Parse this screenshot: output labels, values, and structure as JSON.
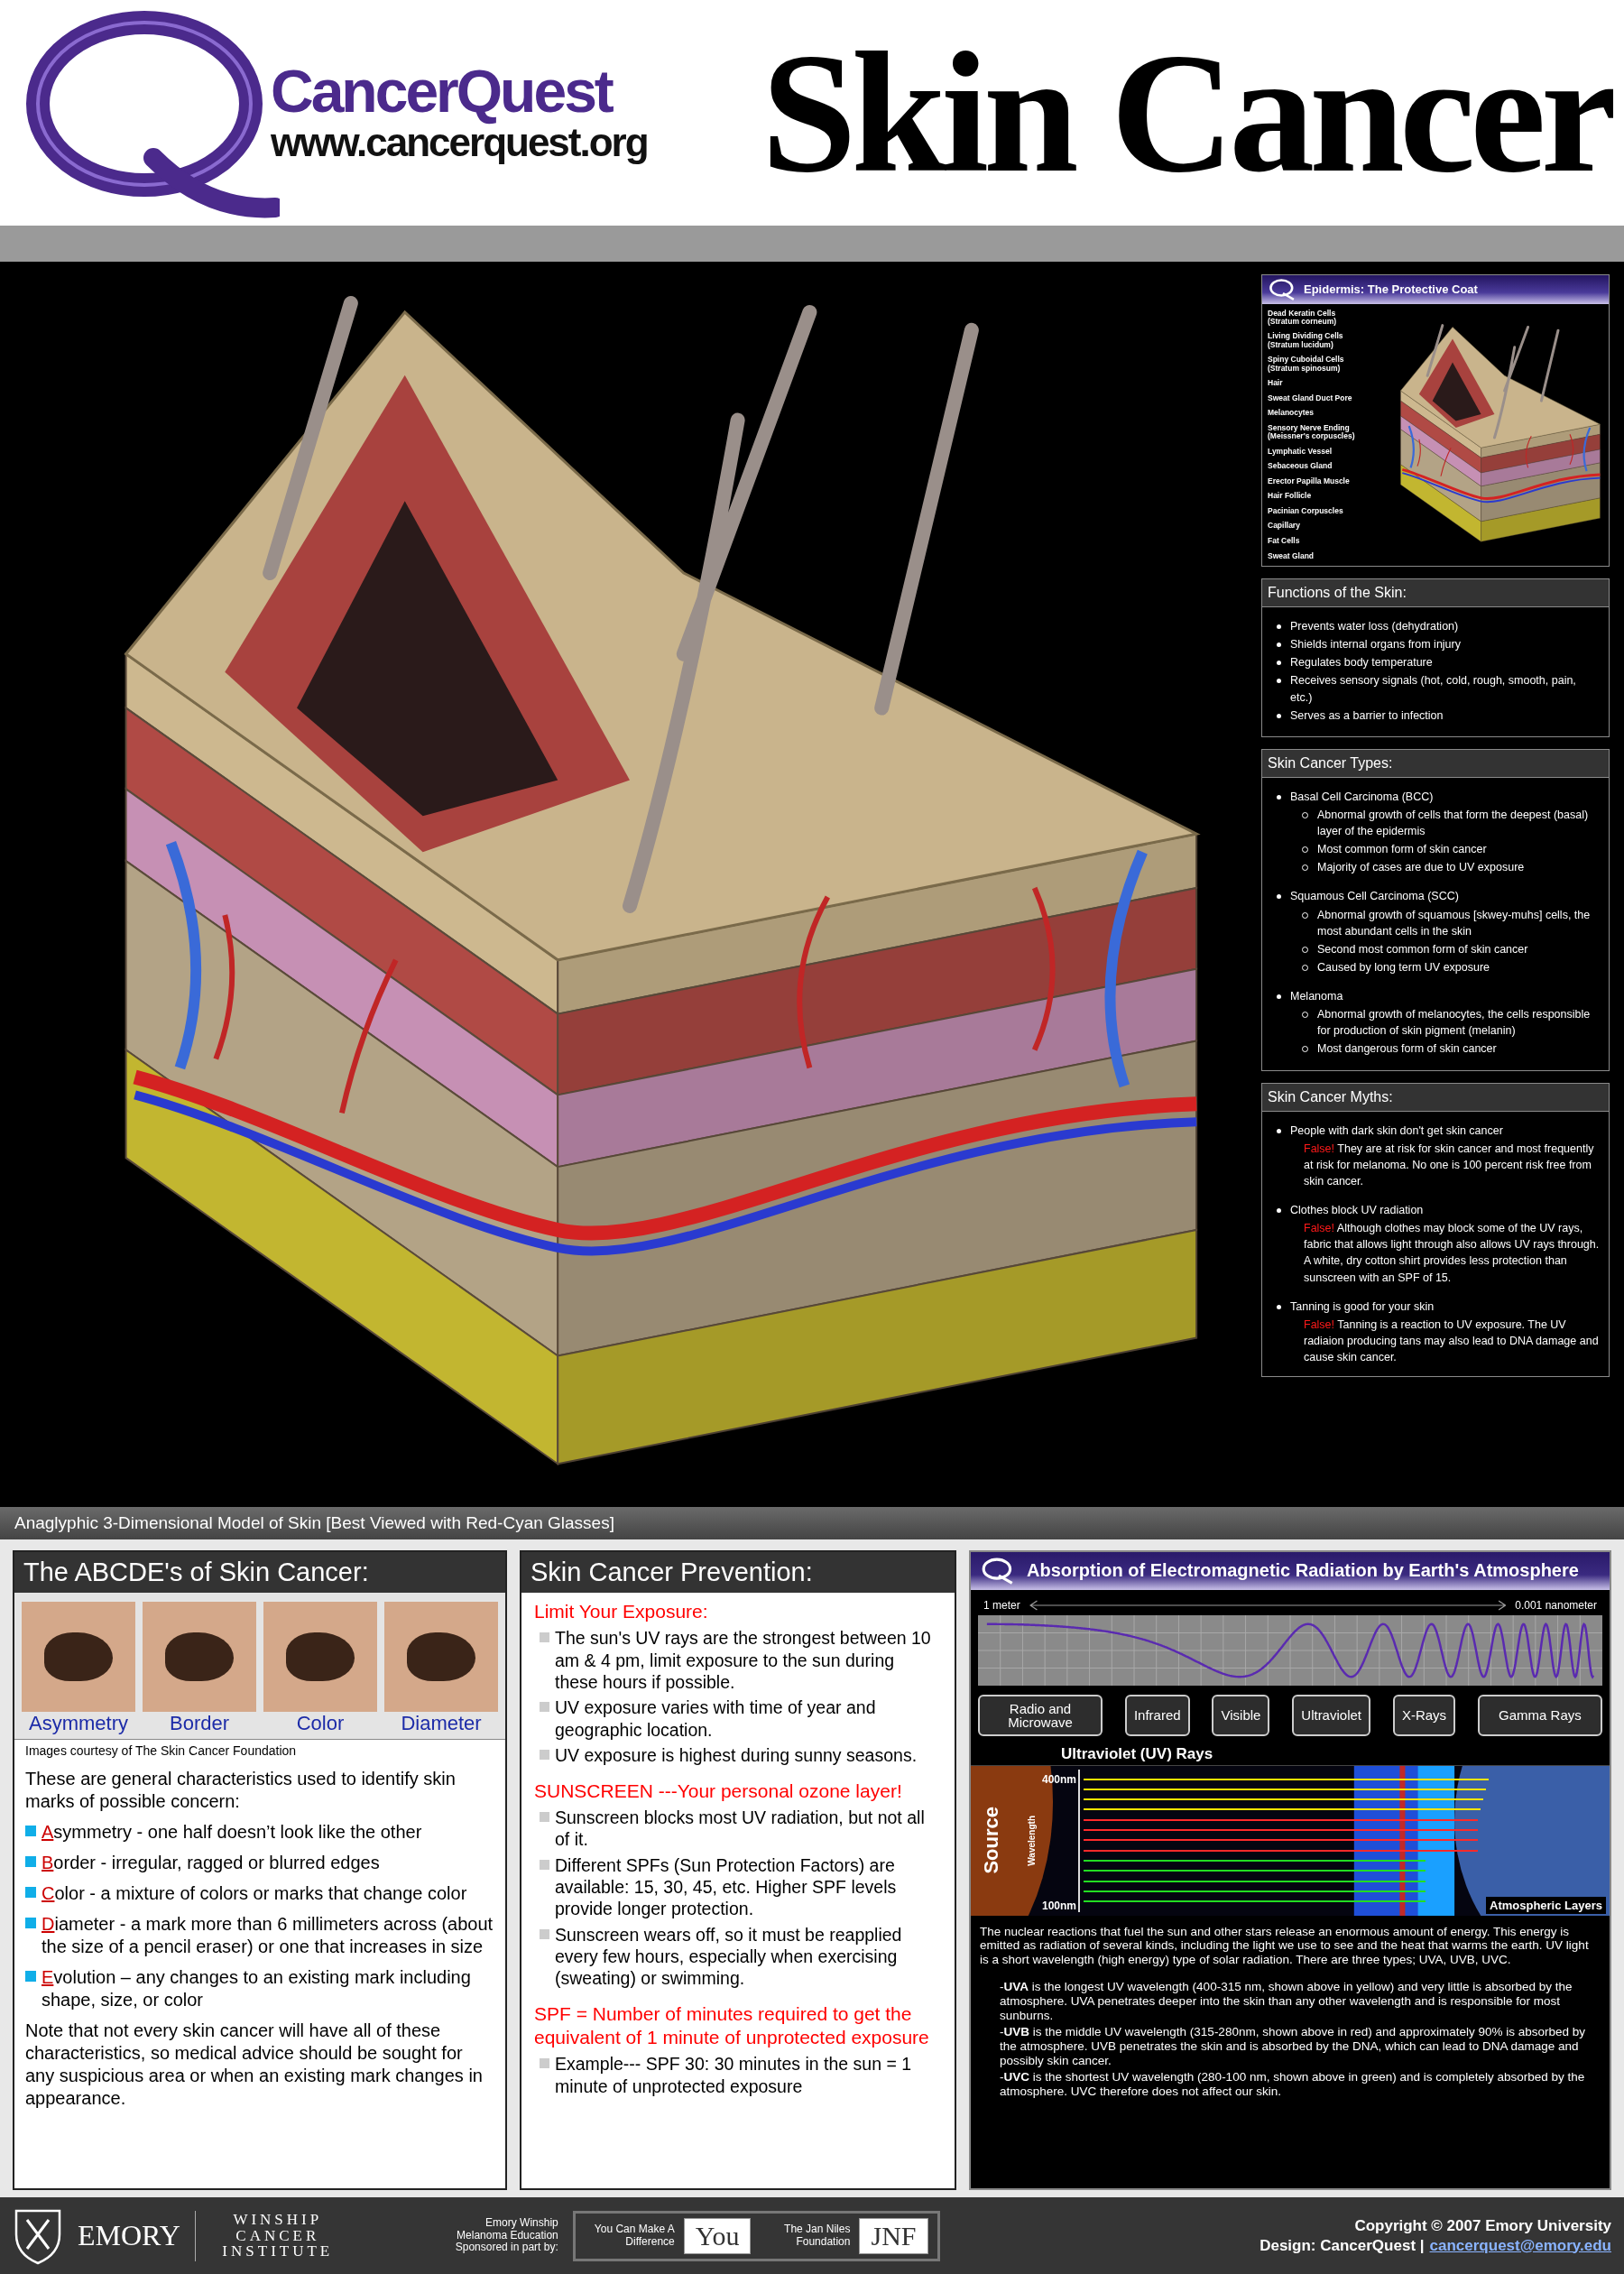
{
  "header": {
    "logo_name": "CancerQuest",
    "logo_url": "www.cancerquest.org",
    "title": "Skin Cancer"
  },
  "epidermis_panel": {
    "title": "Epidermis: The Protective Coat",
    "labels": [
      {
        "name": "Dead Keratin Cells",
        "detail": "(Stratum corneum)"
      },
      {
        "name": "Living Dividing Cells",
        "detail": "(Stratum lucidum)"
      },
      {
        "name": "Spiny Cuboidal Cells",
        "detail": "(Stratum spinosum)"
      },
      {
        "name": "Hair"
      },
      {
        "name": "Sweat Gland Duct Pore"
      },
      {
        "name": "Melanocytes"
      },
      {
        "name": "Sensory Nerve Ending",
        "detail": "(Meissner's corpuscles)"
      },
      {
        "name": "Lymphatic Vessel"
      },
      {
        "name": "Sebaceous Gland"
      },
      {
        "name": "Erector Papilla Muscle"
      },
      {
        "name": "Hair Follicle"
      },
      {
        "name": "Pacinian Corpuscles"
      },
      {
        "name": "Capillary"
      },
      {
        "name": "Fat Cells"
      },
      {
        "name": "Sweat Gland"
      }
    ]
  },
  "functions_panel": {
    "title": "Functions of the Skin:",
    "items": [
      "Prevents water loss (dehydration)",
      "Shields internal organs from injury",
      "Regulates body temperature",
      "Receives sensory signals (hot, cold, rough, smooth, pain, etc.)",
      "Serves as a barrier to infection"
    ]
  },
  "types_panel": {
    "title": "Skin Cancer Types:",
    "items": [
      {
        "name": "Basal Cell Carcinoma (BCC)",
        "details": [
          "Abnormal growth of cells that form the deepest (basal) layer of the epidermis",
          "Most common form of skin cancer",
          "Majority of cases are due to UV exposure"
        ]
      },
      {
        "name": "Squamous Cell Carcinoma (SCC)",
        "details": [
          "Abnormal growth of squamous [skwey-muhs] cells, the most abundant cells in the skin",
          "Second most common form of skin cancer",
          "Caused by long term UV exposure"
        ]
      },
      {
        "name": "Melanoma",
        "details": [
          "Abnormal growth of melanocytes, the cells responsible for production of skin pigment (melanin)",
          "Most dangerous form of skin cancer"
        ]
      }
    ]
  },
  "myths_panel": {
    "title": "Skin Cancer Myths:",
    "items": [
      {
        "myth": "People with dark skin don't get skin cancer",
        "verdict": "False!",
        "explanation": "They are at risk for skin cancer and most frequently at risk for melanoma. No one is 100 percent risk free from skin cancer."
      },
      {
        "myth": "Clothes block UV radiation",
        "verdict": "False!",
        "explanation": "Although clothes may block some of the UV rays, fabric that allows light through also allows UV rays through. A white, dry cotton shirt provides less protection than sunscreen with an SPF of 15."
      },
      {
        "myth": "Tanning is good for your skin",
        "verdict": "False!",
        "explanation": "Tanning is a reaction to UV exposure. The UV radiaion producing tans may also lead to DNA damage and cause skin cancer."
      }
    ]
  },
  "model_caption": "Anaglyphic 3-Dimensional Model of Skin [Best Viewed with Red-Cyan Glasses]",
  "abcde_panel": {
    "title": "The ABCDE's of Skin Cancer:",
    "photos": [
      "Asymmetry",
      "Border",
      "Color",
      "Diameter"
    ],
    "credit": "Images courtesy of The Skin Cancer Foundation",
    "intro": "These are general characteristics used to identify skin marks of possible concern:",
    "items": [
      {
        "initial": "A",
        "text": "symmetry - one half doesn’t look like the other"
      },
      {
        "initial": "B",
        "text": "order - irregular, ragged or blurred edges"
      },
      {
        "initial": "C",
        "text": "olor - a mixture of colors or marks that change color"
      },
      {
        "initial": "D",
        "text": "iameter - a mark more than 6 millimeters across (about the size of a pencil eraser) or one that increases in size"
      },
      {
        "initial": "E",
        "text": "volution – any changes to an existing mark including shape, size, or color"
      }
    ],
    "note": "Note that not every skin cancer will have all of these characteristics, so medical advice should be sought for any suspicious area or when an existing mark changes in appearance."
  },
  "prevention_panel": {
    "title": "Skin Cancer Prevention:",
    "sections": [
      {
        "heading": "Limit Your Exposure:",
        "items": [
          "The sun's UV rays are the strongest between 10 am & 4 pm, limit exposure to the sun during these hours if possible.",
          "UV exposure varies with time of year and geographic location.",
          "UV exposure is highest during sunny seasons."
        ]
      },
      {
        "heading": "SUNSCREEN ---Your personal ozone layer!",
        "items": [
          "Sunscreen blocks most UV radiation, but not all of it.",
          "Different SPFs (Sun Protection Factors) are available: 15, 30, 45, etc.  Higher SPF levels provide longer protection.",
          "Sunscreen wears off, so it must be reapplied every few hours, especially when exercising (sweating) or swimming."
        ]
      },
      {
        "heading": "SPF = Number of minutes required to get the equivalent of 1 minute of unprotected exposure",
        "items": [
          "Example--- SPF 30: 30 minutes in the sun = 1 minute of unprotected exposure"
        ]
      }
    ]
  },
  "radiation_panel": {
    "title": "Absorption of Electromagnetic Radiation by Earth's Atmosphere",
    "scale_start": "1 meter",
    "scale_end": "0.001 nanometer",
    "bands": [
      "Radio and Microwave",
      "Infrared",
      "Visible",
      "Ultraviolet",
      "X-Rays",
      "Gamma Rays"
    ],
    "uv_title": "Ultraviolet (UV) Rays",
    "source_label": "Source",
    "axis_label": "Wavelength",
    "axis_top": "400nm",
    "axis_bottom": "100nm",
    "layers_label": "Atmospheric Layers",
    "rays": [
      {
        "color": "#ffe600",
        "level": 0.77
      },
      {
        "color": "#ffe600",
        "level": 0.765
      },
      {
        "color": "#ffe600",
        "level": 0.76
      },
      {
        "color": "#ffe600",
        "level": 0.755
      },
      {
        "color": "#ff2a2a",
        "level": 0.75
      },
      {
        "color": "#ff2a2a",
        "level": 0.75
      },
      {
        "color": "#ff2a2a",
        "level": 0.75
      },
      {
        "color": "#ff2a2a",
        "level": 0.75
      },
      {
        "color": "#22dd22",
        "level": 0.65
      },
      {
        "color": "#22dd22",
        "level": 0.65
      },
      {
        "color": "#22dd22",
        "level": 0.65
      },
      {
        "color": "#22dd22",
        "level": 0.65
      },
      {
        "color": "#22dd22",
        "level": 0.65
      }
    ],
    "intro": "The nuclear reactions that fuel the sun and other stars release an enormous amount of energy. This energy is emitted as radiation of several kinds, including the light we use to see and the heat that warms the earth.  UV light is a short wavelength (high energy) type of solar radiation. There are three types; UVA, UVB, UVC.",
    "notes": [
      "-**UVA** is the longest UV wavelength (400-315 nm, shown above in yellow) and very little is absorbed by the atmosphere. UVA penetrates deeper into the skin than any other wavelength and is responsible for most sunburns.",
      "-**UVB** is the middle UV wavelength (315-280nm, shown above in red) and approximately 90% is absorbed by the atmosphere. UVB penetrates the skin and is absorbed by the DNA, which can lead to DNA damage and possibly skin cancer.",
      "-**UVC** is the shortest UV wavelength (280-100 nm, shown above in green) and is completely absorbed by the atmosphere. UVC therefore does not affect our skin."
    ]
  },
  "footer": {
    "university": "EMORY",
    "institute": "WINSHIP CANCER INSTITUTE",
    "sponsor_note": "Emory Winship Melanoma Education Sponsored in part by:",
    "sponsors": [
      {
        "name": "You Can Make A Difference",
        "logo": "You"
      },
      {
        "name": "The Jan Niles Foundation",
        "logo": "JNF"
      }
    ],
    "copyright": "Copyright © 2007 Emory University",
    "design": "Design: CancerQuest |",
    "email": "cancerquest@emory.edu"
  }
}
